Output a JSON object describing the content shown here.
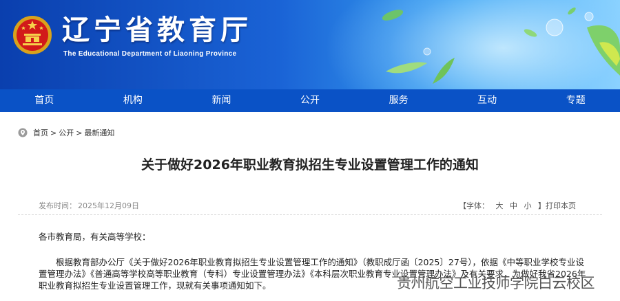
{
  "header": {
    "site_title": "辽宁省教育厅",
    "site_subtitle": "The Educational Department of Liaoning Province",
    "brand_color": "#0a52c6"
  },
  "nav": {
    "items": [
      {
        "label": "首页"
      },
      {
        "label": "机构"
      },
      {
        "label": "新闻"
      },
      {
        "label": "公开"
      },
      {
        "label": "服务"
      },
      {
        "label": "互动"
      },
      {
        "label": "专题"
      }
    ]
  },
  "breadcrumb": {
    "items": [
      "首页",
      "公开",
      "最新通知"
    ],
    "separator": ">"
  },
  "article": {
    "title": "关于做好2026年职业教育拟招生专业设置管理工作的通知",
    "date_label": "发布时间：",
    "date": "2025年12月09日",
    "font_label": "【字体：",
    "font_large": "大",
    "font_medium": "中",
    "font_small": "小",
    "print_label": "】打印本页",
    "salutation": "各市教育局，有关高等学校：",
    "paragraph": "根据教育部办公厅《关于做好2026年职业教育拟招生专业设置管理工作的通知》（教职成厅函〔2025〕27号），依据《中等职业学校专业设置管理办法》《普通高等学校高等职业教育（专科）专业设置管理办法》《本科层次职业教育专业设置管理办法》及有关要求，为做好我省2026年职业教育拟招生专业设置管理工作，现就有关事项通知如下。"
  },
  "watermark": "贵州航空工业技师学院白云校区"
}
